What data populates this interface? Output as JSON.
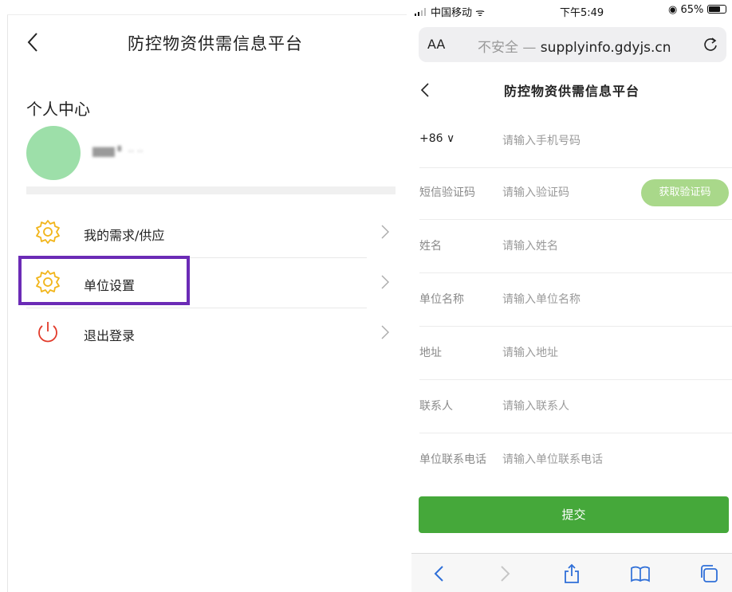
{
  "left": {
    "title": "防控物资供需信息平台",
    "section": "个人中心",
    "user_name": "▇▇▇ ▘  ·· ·· ",
    "menu": [
      {
        "label": "我的需求/供应",
        "icon": "gear-icon"
      },
      {
        "label": "单位设置",
        "icon": "gear-icon"
      },
      {
        "label": "退出登录",
        "icon": "power-icon"
      }
    ],
    "colors": {
      "gear": "#f2b51a",
      "power": "#e23a2a",
      "highlight": "#6b2bb6",
      "avatar": "#9ddfa9"
    }
  },
  "right": {
    "status": {
      "carrier": "中国移动",
      "time": "下午5:49",
      "battery": "65%"
    },
    "urlbar": {
      "aa": "AA",
      "insecure": "不安全 —",
      "domain": " supplyinfo.gdyjs.cn"
    },
    "title": "防控物资供需信息平台",
    "fields": [
      {
        "key": "+86 ∨",
        "placeholder": "请输入手机号码"
      },
      {
        "key": "短信验证码",
        "placeholder": "请输入验证码"
      },
      {
        "key": "姓名",
        "placeholder": "请输入姓名"
      },
      {
        "key": "单位名称",
        "placeholder": "请输入单位名称"
      },
      {
        "key": "地址",
        "placeholder": "请输入地址"
      },
      {
        "key": "联系人",
        "placeholder": "请输入联系人"
      },
      {
        "key": "单位联系电话",
        "placeholder": "请输入单位联系电话"
      }
    ],
    "get_code": "获取验证码",
    "submit": "提交",
    "toolbar_icons": [
      "back-icon",
      "forward-icon",
      "share-icon",
      "bookmarks-icon",
      "tabs-icon"
    ],
    "colors": {
      "primary": "#45a83a",
      "code_button": "#a9d88a"
    }
  }
}
